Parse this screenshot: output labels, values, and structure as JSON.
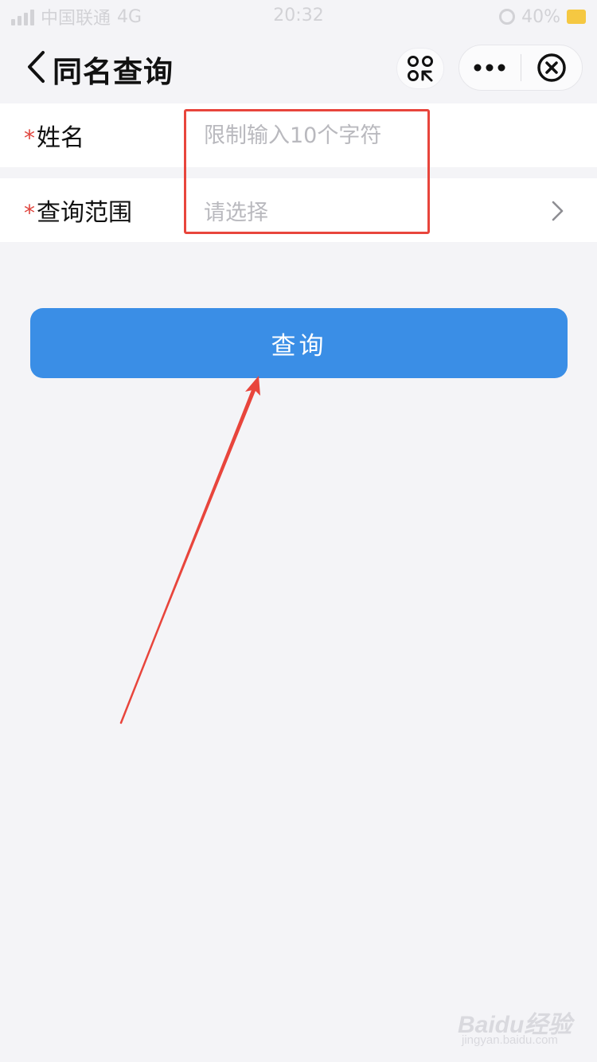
{
  "status_bar": {
    "carrier": "中国联通",
    "network": "4G",
    "time": "20:32",
    "battery": "40%"
  },
  "nav": {
    "title": "同名查询",
    "back_icon": "chevron-left-icon",
    "scan_icon": "scan-icon",
    "more_icon": "more-dots-icon",
    "close_icon": "close-circle-icon"
  },
  "form": {
    "required_mark": "*",
    "name_field": {
      "label": "姓名",
      "placeholder": "限制输入10个字符",
      "value": ""
    },
    "range_field": {
      "label": "查询范围",
      "placeholder": "请选择"
    }
  },
  "query_button": {
    "label": "查询"
  },
  "watermark": {
    "text": "Baidu经验",
    "sub": "jingyan.baidu.com"
  },
  "colors": {
    "primary": "#3a8ee6",
    "required": "#e0463f",
    "annotation": "#e8453c",
    "background": "#f4f4f7"
  }
}
